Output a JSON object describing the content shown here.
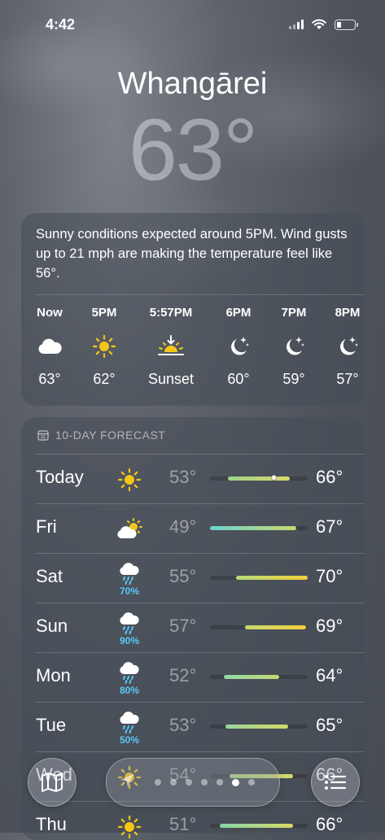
{
  "status_bar": {
    "time": "4:42"
  },
  "location": {
    "city": "Whangārei",
    "temperature": "63°"
  },
  "hourly": {
    "summary": "Sunny conditions expected around 5PM. Wind gusts up to 21 mph are making the temperature feel like 56°.",
    "items": [
      {
        "time": "Now",
        "icon": "cloud-icon",
        "value": "63°"
      },
      {
        "time": "5PM",
        "icon": "sun-icon",
        "value": "62°"
      },
      {
        "time": "5:57PM",
        "icon": "sunset-icon",
        "value": "Sunset"
      },
      {
        "time": "6PM",
        "icon": "moon-stars-icon",
        "value": "60°"
      },
      {
        "time": "7PM",
        "icon": "moon-stars-icon",
        "value": "59°"
      },
      {
        "time": "8PM",
        "icon": "moon-stars-icon",
        "value": "57°"
      }
    ]
  },
  "forecast": {
    "header": "10-DAY FORECAST",
    "days": [
      {
        "day": "Today",
        "icon": "sun-icon",
        "precip": "",
        "low": "53°",
        "high": "66°",
        "range_start": 0.18,
        "range_end": 0.82,
        "current": 0.65,
        "colors": [
          "#9fd28a",
          "#d9d867"
        ]
      },
      {
        "day": "Fri",
        "icon": "partly-sunny-icon",
        "precip": "",
        "low": "49°",
        "high": "67°",
        "range_start": 0.0,
        "range_end": 0.88,
        "colors": [
          "#6ad3d0",
          "#c9d86c"
        ]
      },
      {
        "day": "Sat",
        "icon": "rain-cloud-icon",
        "precip": "70%",
        "low": "55°",
        "high": "70°",
        "range_start": 0.27,
        "range_end": 1.0,
        "colors": [
          "#b7d97a",
          "#f2cf3a"
        ]
      },
      {
        "day": "Sun",
        "icon": "rain-cloud-icon",
        "precip": "90%",
        "low": "57°",
        "high": "69°",
        "range_start": 0.36,
        "range_end": 0.98,
        "colors": [
          "#c6d86e",
          "#f2cf3a"
        ]
      },
      {
        "day": "Mon",
        "icon": "rain-cloud-icon",
        "precip": "80%",
        "low": "52°",
        "high": "64°",
        "range_start": 0.14,
        "range_end": 0.71,
        "colors": [
          "#8ed8a8",
          "#c7d872"
        ]
      },
      {
        "day": "Tue",
        "icon": "rain-cloud-icon",
        "precip": "50%",
        "low": "53°",
        "high": "65°",
        "range_start": 0.16,
        "range_end": 0.8,
        "colors": [
          "#96d79e",
          "#d4d868"
        ]
      },
      {
        "day": "Wed",
        "icon": "sun-icon",
        "precip": "",
        "low": "54°",
        "high": "66°",
        "range_start": 0.2,
        "range_end": 0.85,
        "colors": [
          "#a8d684",
          "#d9d867"
        ]
      },
      {
        "day": "Thu",
        "icon": "sun-icon",
        "precip": "",
        "low": "51°",
        "high": "66°",
        "range_start": 0.1,
        "range_end": 0.85,
        "colors": [
          "#86d6a8",
          "#d9d867"
        ]
      }
    ]
  },
  "pager": {
    "count": 7,
    "active_index": 5
  }
}
